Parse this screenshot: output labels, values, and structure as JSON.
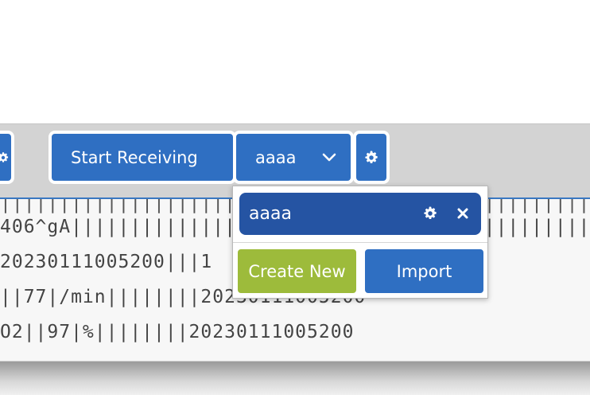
{
  "toolbar": {
    "start_label": "Start Receiving",
    "selected_profile": "aaaa",
    "chevron_icon": "chevron-down-icon",
    "gear_icon": "gear-icon"
  },
  "log": {
    "ticks": "||||||||||||||||||||||||||||||||||||||||||||||||||||||||||||||||||||",
    "lines": [
      "406^gA||||||||||||||||||||||||||||||||||||||||||||||||||||",
      "20230111005200|||1",
      "||77|/min||||||||20230111005200",
      "O2||97|%||||||||20230111005200"
    ]
  },
  "dropdown": {
    "item_label": "aaaa",
    "create_label": "Create New",
    "import_label": "Import"
  },
  "colors": {
    "primary": "#2f6fc2",
    "selected": "#2554a3",
    "create": "#9dbb3b"
  }
}
